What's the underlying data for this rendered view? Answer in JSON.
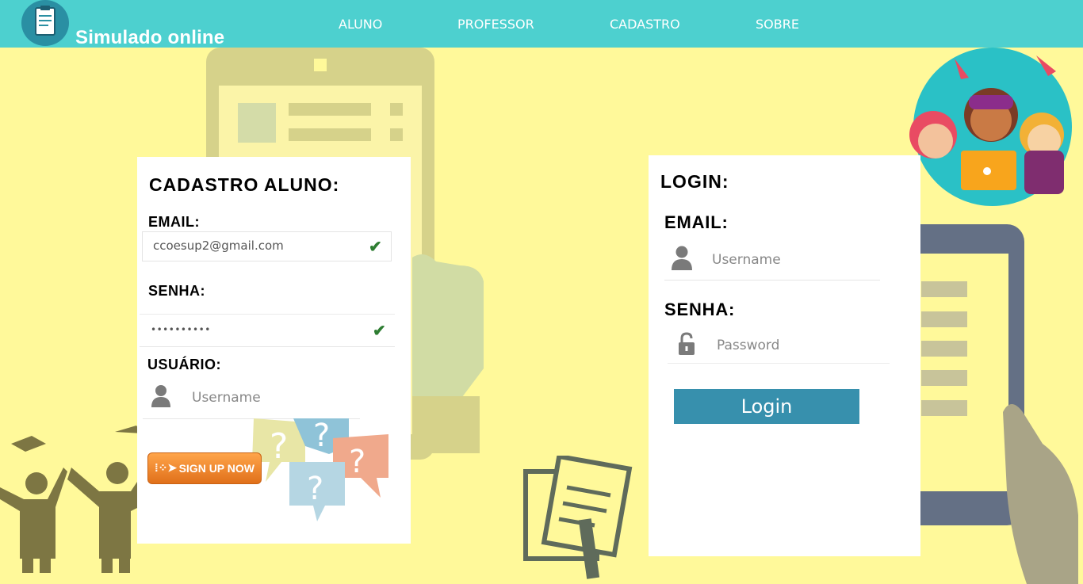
{
  "brand": {
    "title": "Simulado online",
    "logo_icon": "clipboard-icon"
  },
  "nav": {
    "items": [
      "ALUNO",
      "PROFESSOR",
      "CADASTRO",
      "SOBRE"
    ]
  },
  "register": {
    "title": "CADASTRO ALUNO:",
    "email_label": "EMAIL:",
    "email_value": "ccoesup2@gmail.com",
    "senha_label": "SENHA:",
    "senha_value": "••••••••••",
    "usuario_label": "USUÁRIO:",
    "usuario_placeholder": "Username",
    "signup_label": "SIGN UP NOW"
  },
  "login": {
    "title": "LOGIN:",
    "email_label": "EMAIL:",
    "username_placeholder": "Username",
    "senha_label": "SENHA:",
    "password_placeholder": "Password",
    "button_label": "Login"
  },
  "colors": {
    "nav": "#4dd0cf",
    "background": "#fff99a",
    "login_button": "#3790ad",
    "signup_button": "#f08a24"
  }
}
